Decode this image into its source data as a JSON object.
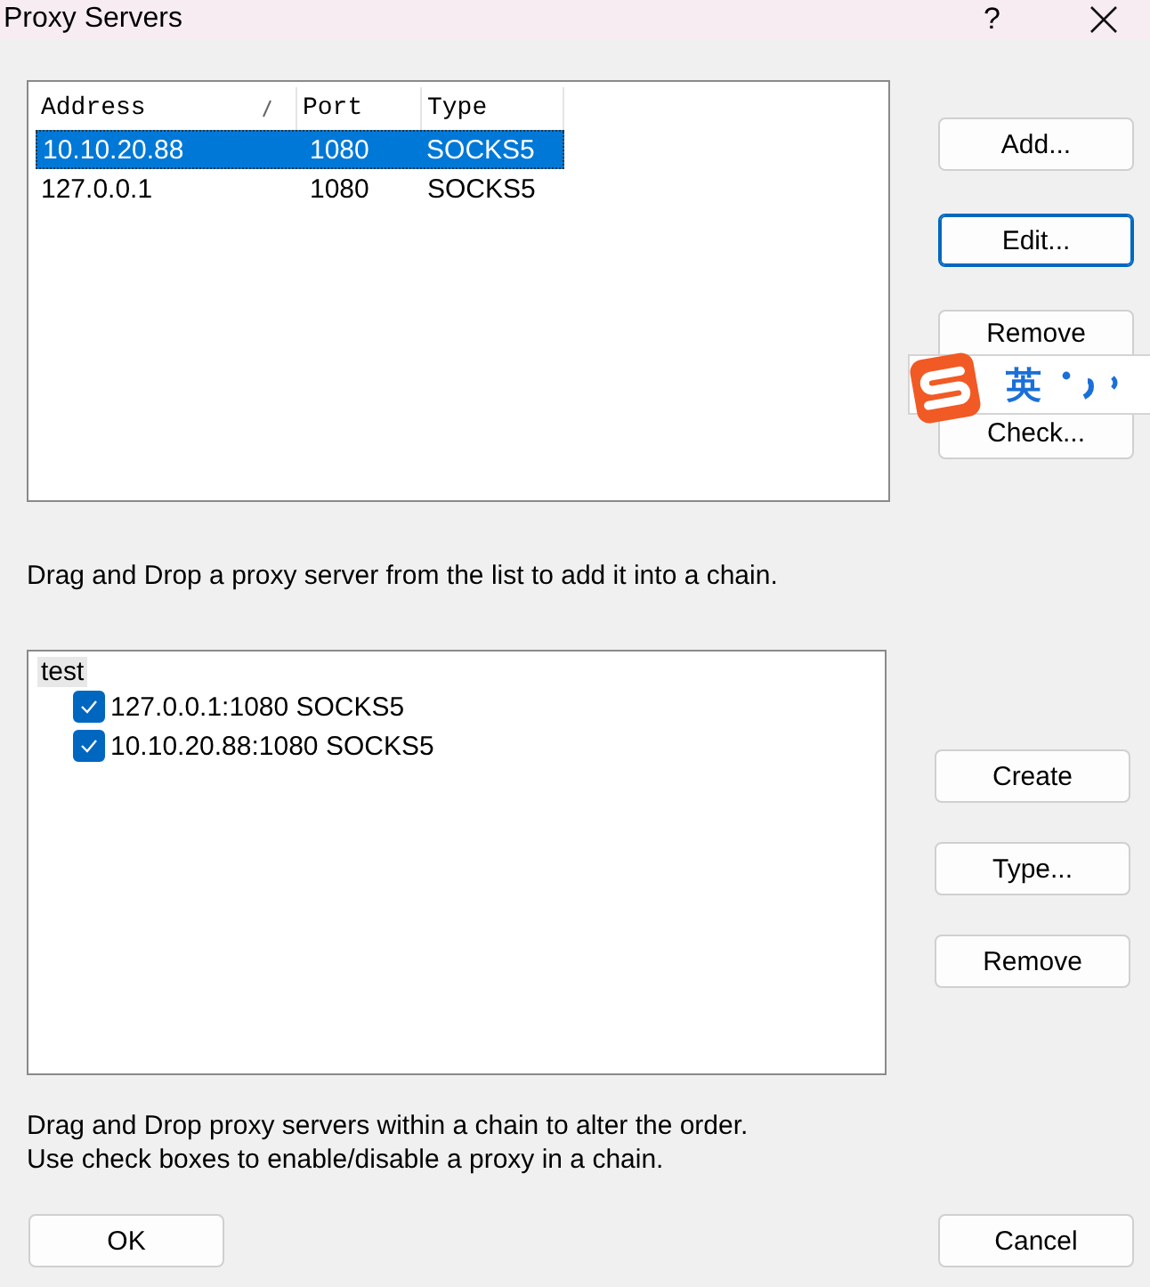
{
  "window": {
    "title": "Proxy Servers",
    "help": "?"
  },
  "proxy_table": {
    "columns": [
      {
        "label": "Address",
        "sorted": true
      },
      {
        "label": "Port",
        "sorted": false
      },
      {
        "label": "Type",
        "sorted": false
      }
    ],
    "rows": [
      {
        "cells": [
          "10.10.20.88",
          "1080",
          "SOCKS5"
        ],
        "selected": true
      },
      {
        "cells": [
          "127.0.0.1",
          "1080",
          "SOCKS5"
        ],
        "selected": false
      }
    ]
  },
  "proxy_buttons": [
    {
      "label": "Add...",
      "focused": false
    },
    {
      "label": "Edit...",
      "focused": true
    },
    {
      "label": "Remove",
      "focused": false
    },
    {
      "label": "Check...",
      "focused": false
    }
  ],
  "list_hint": "Drag and Drop a proxy server from the list to add it into a chain.",
  "chains": [
    {
      "label": "test",
      "selected": true,
      "children": [
        {
          "label": "127.0.0.1:1080 SOCKS5",
          "checked": true
        },
        {
          "label": "10.10.20.88:1080 SOCKS5",
          "checked": true
        }
      ]
    }
  ],
  "chain_buttons": [
    {
      "label": "Create"
    },
    {
      "label": "Type..."
    },
    {
      "label": "Remove"
    }
  ],
  "chain_hints": [
    "Drag and Drop proxy servers within a chain to alter the order.",
    "Use check boxes to enable/disable a proxy in a chain."
  ],
  "footer_buttons": [
    {
      "label": "OK"
    },
    {
      "label": "Cancel"
    }
  ],
  "ime_toolbar": {
    "mode": "英"
  }
}
